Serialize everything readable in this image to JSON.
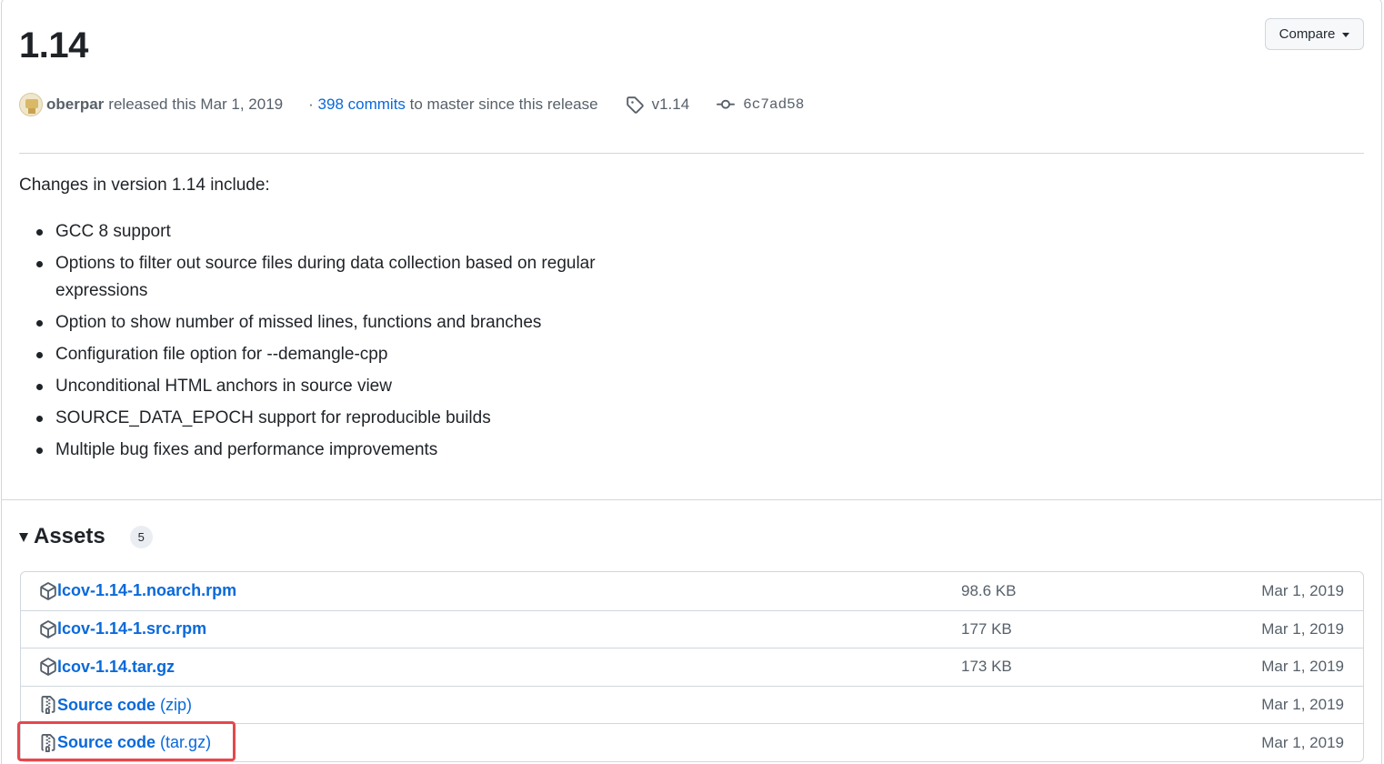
{
  "release": {
    "title": "1.14",
    "compare_label": "Compare",
    "author": "oberpar",
    "released_text": "released this Mar 1, 2019",
    "commits_prefix": "·",
    "commits_link": "398 commits",
    "commits_suffix": "to master since this release",
    "tag": "v1.14",
    "commit_sha": "6c7ad58"
  },
  "notes": {
    "intro": "Changes in version 1.14 include:",
    "items": [
      "GCC 8 support",
      "Options to filter out source files during data collection based on regular expressions",
      "Option to show number of missed lines, functions and branches",
      "Configuration file option for --demangle-cpp",
      "Unconditional HTML anchors in source view",
      "SOURCE_DATA_EPOCH support for reproducible builds",
      "Multiple bug fixes and performance improvements"
    ]
  },
  "assets": {
    "title": "Assets",
    "count": "5",
    "rows": [
      {
        "name": "lcov-1.14-1.noarch.rpm",
        "suffix": "",
        "size": "98.6 KB",
        "date": "Mar 1, 2019",
        "icon": "package-icon"
      },
      {
        "name": "lcov-1.14-1.src.rpm",
        "suffix": "",
        "size": "177 KB",
        "date": "Mar 1, 2019",
        "icon": "package-icon"
      },
      {
        "name": "lcov-1.14.tar.gz",
        "suffix": "",
        "size": "173 KB",
        "date": "Mar 1, 2019",
        "icon": "package-icon"
      },
      {
        "name": "Source code",
        "suffix": "(zip)",
        "size": "",
        "date": "Mar 1, 2019",
        "icon": "file-zip-icon"
      },
      {
        "name": "Source code",
        "suffix": "(tar.gz)",
        "size": "",
        "date": "Mar 1, 2019",
        "icon": "file-zip-icon"
      }
    ]
  },
  "colors": {
    "link": "#0969da",
    "muted": "#57606a",
    "border": "#d0d7de",
    "highlight": "#e5484d"
  }
}
